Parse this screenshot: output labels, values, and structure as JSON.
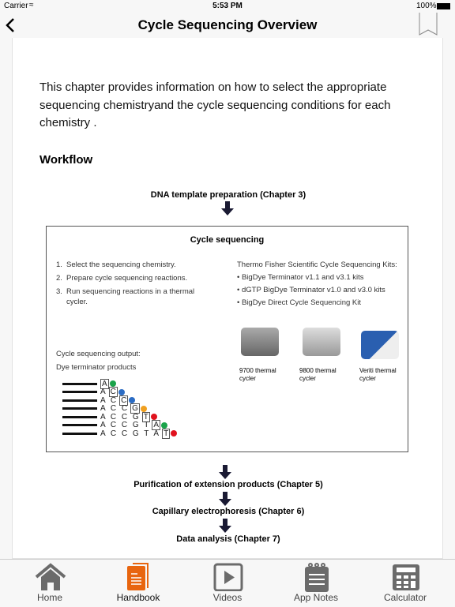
{
  "status": {
    "carrier": "Carrier",
    "time": "5:53 PM",
    "battery": "100%"
  },
  "nav": {
    "title": "Cycle Sequencing Overview",
    "back_icon": "chevron-left-icon",
    "bookmark_icon": "bookmark-icon"
  },
  "content": {
    "intro": "This chapter provides information on how to select the appropriate sequencing chemistryand the cycle sequencing conditions for each chemistry .",
    "workflow_heading": "Workflow",
    "step1": "DNA template preparation (Chapter 3)",
    "box": {
      "title": "Cycle sequencing",
      "steps": [
        "Select the sequencing chemistry.",
        "Prepare cycle sequencing reactions.",
        "Run sequencing reactions in a thermal cycler."
      ],
      "kits_heading": "Thermo Fisher Scientific Cycle Sequencing Kits:",
      "kits": [
        "BigDye Terminator v1.1 and v3.1 kits",
        "dGTP BigDye Terminator v1.0 and v3.0 kits",
        "BigDye Direct Cycle Sequencing Kit"
      ],
      "output_label": "Cycle sequencing output:",
      "output_type": "Dye terminator products",
      "sequences": [
        {
          "prefix": "",
          "last": "A",
          "color": "#1aa34a"
        },
        {
          "prefix": "A",
          "last": "C",
          "color": "#2b6cc4"
        },
        {
          "prefix": "A C",
          "last": "C",
          "color": "#2b6cc4"
        },
        {
          "prefix": "A C C",
          "last": "G",
          "color": "#f0a020"
        },
        {
          "prefix": "A C C G",
          "last": "T",
          "color": "#e0121e"
        },
        {
          "prefix": "A C C G T",
          "last": "A",
          "color": "#1aa34a"
        },
        {
          "prefix": "A C C G T A",
          "last": "T",
          "color": "#e0121e"
        }
      ],
      "cyclers": [
        "9700 thermal cycler",
        "9800 thermal cycler",
        "Veriti thermal cycler"
      ]
    },
    "step2": "Purification of extension products (Chapter 5)",
    "step3": "Capillary electrophoresis (Chapter 6)",
    "step4": "Data analysis (Chapter 7)"
  },
  "tabs": [
    {
      "label": "Home",
      "icon": "home-icon"
    },
    {
      "label": "Handbook",
      "icon": "handbook-icon",
      "active": true
    },
    {
      "label": "Videos",
      "icon": "play-icon"
    },
    {
      "label": "App Notes",
      "icon": "notepad-icon"
    },
    {
      "label": "Calculator",
      "icon": "calculator-icon"
    }
  ],
  "colors": {
    "active_tab": "#e8650f",
    "inactive_tab": "#6b6b6b"
  }
}
